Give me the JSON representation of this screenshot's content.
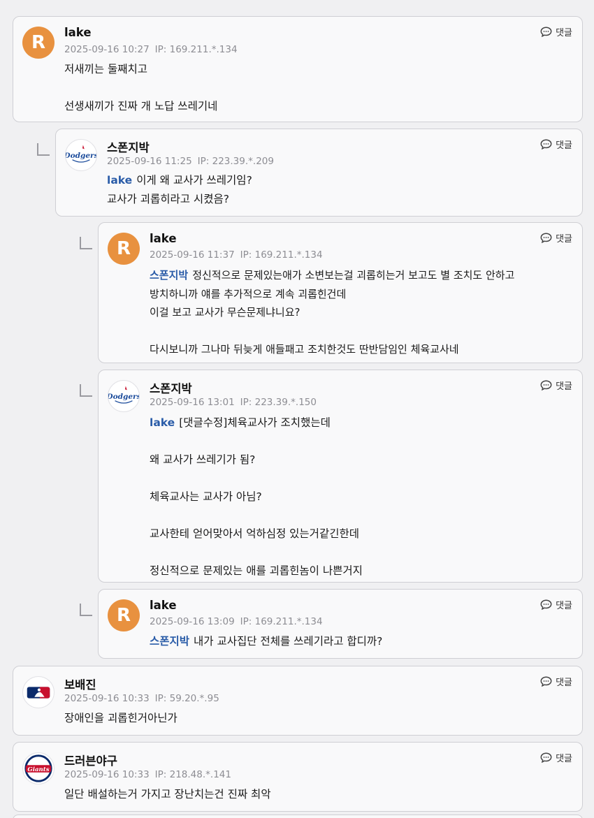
{
  "reply_label": "댓글",
  "comments": [
    {
      "author": "lake",
      "date": "2025-09-16 10:27",
      "ip": "IP: 169.211.*.134",
      "avatar_letter": "R",
      "avatar_type": "letter",
      "mention": "",
      "lines": [
        "저새끼는 둘째치고",
        "",
        "선생새끼가 진짜 개 노답 쓰레기네"
      ]
    },
    {
      "author": "스폰지박",
      "date": "2025-09-16 11:25",
      "ip": "IP: 223.39.*.209",
      "avatar_type": "dodgers-logo",
      "avatar_text": "Dodgers",
      "mention": "lake",
      "lines": [
        "이게 왜 교사가 쓰레기임?",
        "교사가 괴롭히라고 시켰음?"
      ]
    },
    {
      "author": "lake",
      "date": "2025-09-16 11:37",
      "ip": "IP: 169.211.*.134",
      "avatar_letter": "R",
      "avatar_type": "letter",
      "mention": "스폰지박",
      "lines": [
        "정신적으로 문제있는애가 소변보는걸 괴롭히는거 보고도 별 조치도 안하고",
        "방치하니까 얘를 추가적으로 계속 괴롭힌건데",
        "이걸 보고 교사가 무슨문제냐니요?",
        "",
        "다시보니까 그나마 뒤늦게 애들패고 조치한것도 딴반담임인 체육교사네"
      ]
    },
    {
      "author": "스폰지박",
      "date": "2025-09-16 13:01",
      "ip": "IP: 223.39.*.150",
      "avatar_type": "dodgers-logo",
      "avatar_text": "Dodgers",
      "mention": "lake",
      "lines": [
        "[댓글수정]체육교사가 조치했는데",
        "",
        "왜 교사가 쓰레기가 됨?",
        "",
        "체육교사는 교사가 아님?",
        "",
        "교사한테 얻어맞아서 억하심정 있는거같긴한데",
        "",
        "정신적으로 문제있는 애를 괴롭힌놈이 나쁜거지"
      ]
    },
    {
      "author": "lake",
      "date": "2025-09-16 13:09",
      "ip": "IP: 169.211.*.134",
      "avatar_letter": "R",
      "avatar_type": "letter",
      "mention": "스폰지박",
      "lines": [
        "내가 교사집단 전체를 쓰레기라고 합디까?"
      ]
    },
    {
      "author": "보배진",
      "date": "2025-09-16 10:33",
      "ip": "IP: 59.20.*.95",
      "avatar_type": "mlb-logo",
      "mention": "",
      "lines": [
        "장애인을 괴롭힌거아닌가"
      ]
    },
    {
      "author": "드러븐야구",
      "date": "2025-09-16 10:33",
      "ip": "IP: 218.48.*.141",
      "avatar_type": "giants-logo",
      "avatar_text": "Giants",
      "mention": "",
      "lines": [
        "일단 배설하는거 가지고 장난치는건 진짜 최악"
      ]
    }
  ]
}
